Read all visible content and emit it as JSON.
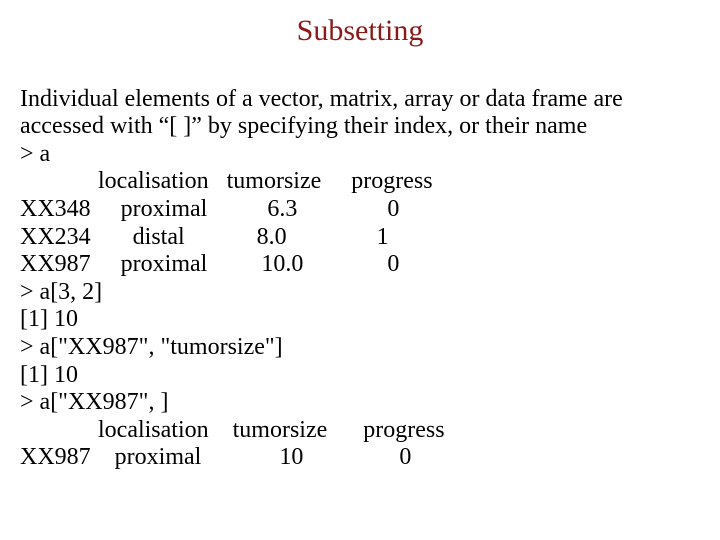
{
  "title": "Subsetting",
  "intro_line1": "Individual elements of a vector, matrix, array or data frame are",
  "intro_line2": "accessed with “[ ]” by specifying their index, or their name",
  "p_a": "> a",
  "hdr1": "             localisation   tumorsize     progress",
  "row1": "XX348     proximal          6.3               0",
  "row2": "XX234       distal            8.0               1",
  "row3": "XX987     proximal         10.0              0",
  "p_a32": "> a[3, 2]",
  "r_a32": "[1] 10",
  "p_axx": "> a[\"XX987\", \"tumorsize\"]",
  "r_axx": "[1] 10",
  "p_row": "> a[\"XX987\", ]",
  "hdr2": "             localisation    tumorsize      progress",
  "row4": "XX987    proximal             10                0"
}
